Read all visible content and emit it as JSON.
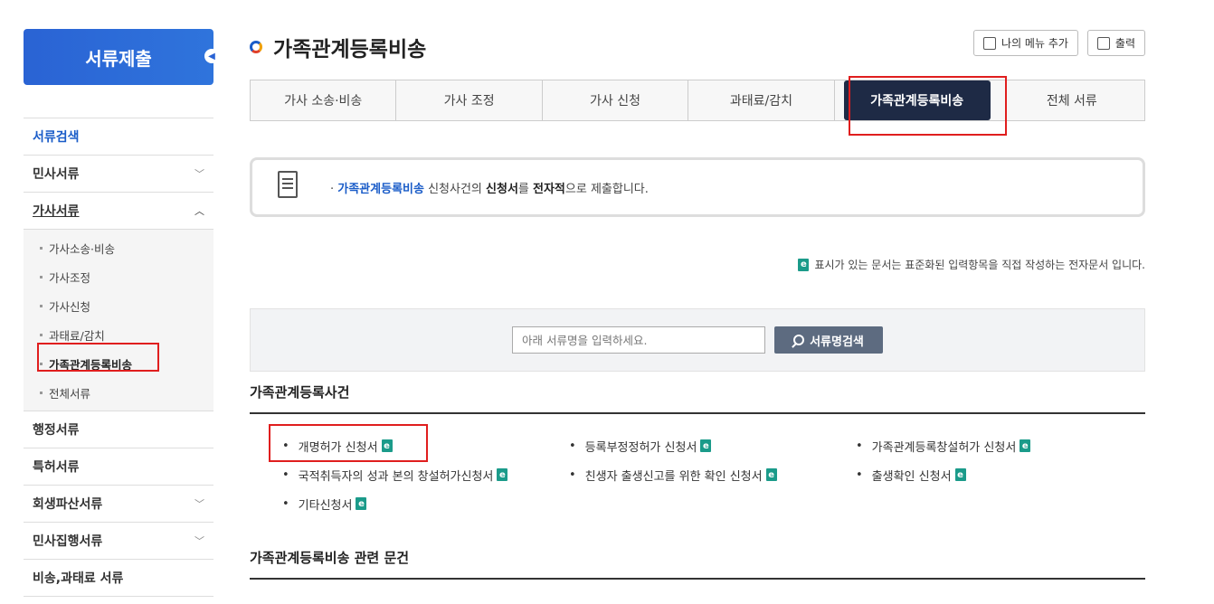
{
  "sidebar": {
    "header": "서류제출",
    "items": [
      {
        "label": "서류검색"
      },
      {
        "label": "민사서류"
      },
      {
        "label": "가사서류"
      },
      {
        "label": "행정서류"
      },
      {
        "label": "특허서류"
      },
      {
        "label": "회생파산서류"
      },
      {
        "label": "민사집행서류"
      },
      {
        "label": "비송,과태료 서류"
      }
    ],
    "sub_items": [
      "가사소송·비송",
      "가사조정",
      "가사신청",
      "과태료/감치",
      "가족관계등록비송",
      "전체서류"
    ]
  },
  "page": {
    "title": "가족관계등록비송",
    "my_menu_label": "나의 메뉴 추가",
    "print_label": "출력"
  },
  "tabs": [
    "가사 소송·비송",
    "가사 조정",
    "가사 신청",
    "과태료/감치",
    "가족관계등록비송",
    "전체 서류"
  ],
  "notice": {
    "highlight": "가족관계등록비송",
    "text1": " 신청사건의 ",
    "bold1": "신청서",
    "text2": "를 ",
    "bold2": "전자적",
    "text3": "으로 제출합니다."
  },
  "legend": {
    "icon_letter": "e",
    "text": "표시가 있는 문서는 표준화된 입력항목을 직접 작성하는 전자문서 입니다."
  },
  "search": {
    "placeholder": "아래 서류명을 입력하세요.",
    "button": "서류명검색"
  },
  "section1": {
    "title": "가족관계등록사건",
    "docs": [
      "개명허가 신청서",
      "등록부정정허가 신청서",
      "가족관계등록창설허가 신청서",
      "국적취득자의 성과 본의 창설허가신청서",
      "친생자 출생신고를 위한 확인 신청서",
      "출생확인 신청서",
      "기타신청서"
    ]
  },
  "section2": {
    "title": "가족관계등록비송 관련 문건"
  },
  "colors": {
    "brand": "#2a63d4",
    "active_tab": "#1e2a45",
    "highlight_box": "#e01e1e",
    "e_icon": "#1b9b8a"
  }
}
